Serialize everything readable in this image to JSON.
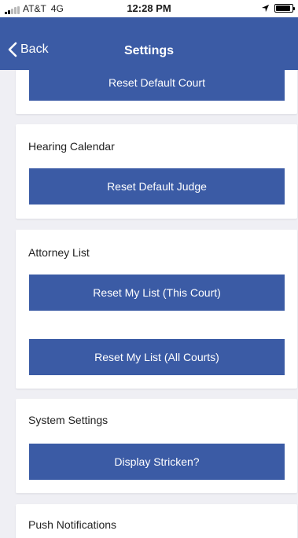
{
  "status_bar": {
    "carrier": "AT&T",
    "network": "4G",
    "time": "12:28 PM",
    "signal_bars_active": 2,
    "signal_bars_total": 5,
    "battery_level": 0.9
  },
  "nav": {
    "back_label": "Back",
    "title": "Settings"
  },
  "sections": [
    {
      "title": "",
      "buttons": [
        "Reset Default Court"
      ]
    },
    {
      "title": "Hearing Calendar",
      "buttons": [
        "Reset Default Judge"
      ]
    },
    {
      "title": "Attorney List",
      "buttons": [
        "Reset My List (This Court)",
        "Reset My List (All Courts)"
      ]
    },
    {
      "title": "System Settings",
      "buttons": [
        "Display Stricken?"
      ]
    },
    {
      "title": "Push Notifications",
      "buttons": []
    }
  ],
  "colors": {
    "primary": "#3b5ba5",
    "background": "#efeff4",
    "card": "#ffffff"
  }
}
